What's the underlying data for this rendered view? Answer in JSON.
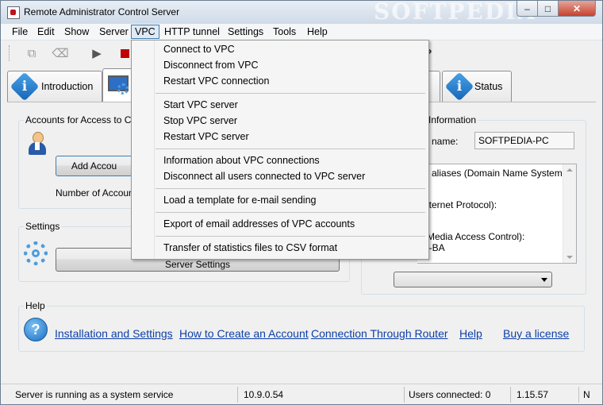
{
  "window": {
    "title": "Remote Administrator Control Server",
    "watermark": "SOFTPEDIA",
    "minimize": "–",
    "maximize": "□",
    "close": "✕"
  },
  "menubar": {
    "items": [
      "File",
      "Edit",
      "Show",
      "Server",
      "VPC",
      "HTTP tunnel",
      "Settings",
      "Tools",
      "Help"
    ],
    "active": "VPC"
  },
  "toolbar": {
    "icons": [
      "copy-icon",
      "eraser-icon",
      "play-icon",
      "stop-icon",
      "help-icon"
    ]
  },
  "tabs": {
    "introduction": "Introduction",
    "status": "Status"
  },
  "accounts": {
    "group_title": "Accounts for Access to Con",
    "add_button": "Add Accou",
    "count_label": "Number of Accounts"
  },
  "settings": {
    "group_title": "Settings",
    "button": "Server Settings"
  },
  "info": {
    "group_title": "Information",
    "computer_name_label": "er name:",
    "computer_name_value": "SOFTPEDIA-PC",
    "dns_label": "d aliases (Domain Name System):",
    "ip_label": "nternet Protocol):",
    "mac_label": "(Media Access Control):",
    "mac_value": "3-BA"
  },
  "help": {
    "group_title": "Help",
    "links": [
      "Installation and Settings",
      "How to Create an Account",
      "Connection Through Router",
      "Help",
      "Buy a license"
    ]
  },
  "statusbar": {
    "message": "Server is running as a system service",
    "ip": "10.9.0.54",
    "users": "Users connected: 0",
    "version": "1.15.57",
    "mode": "N"
  },
  "vpc_menu": {
    "groups": [
      [
        "Connect to VPC",
        "Disconnect from VPC",
        "Restart VPC connection"
      ],
      [
        "Start VPC server",
        "Stop VPC server",
        "Restart VPC server"
      ],
      [
        "Information about VPC connections",
        "Disconnect all users connected to VPC server"
      ],
      [
        "Load a template for e-mail sending"
      ],
      [
        "Export of email addresses of VPC accounts"
      ],
      [
        "Transfer of statistics files to CSV format"
      ]
    ]
  }
}
